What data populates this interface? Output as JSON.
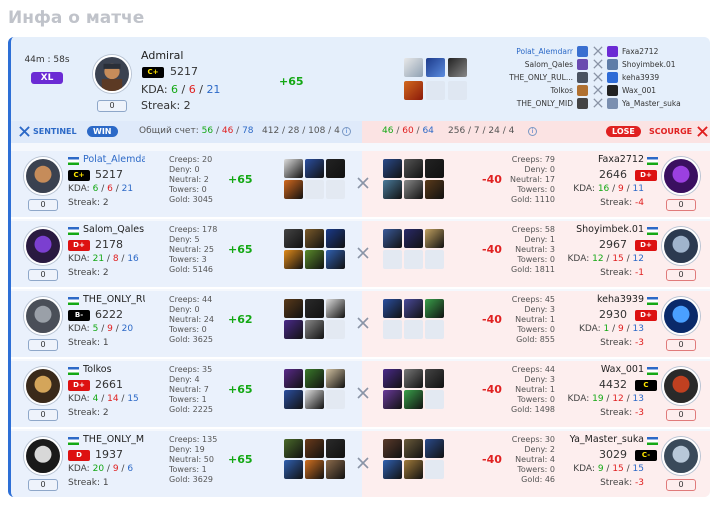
{
  "page": {
    "title": "Инфа о матче"
  },
  "header": {
    "duration": "44m : 58s",
    "mode": "XL",
    "player": {
      "name": "Admiral",
      "rank": "C+",
      "rating": "5217",
      "kda_label": "KDA:",
      "kills": "6",
      "deaths": "6",
      "assists": "21",
      "streak_label": "Streak:",
      "streak": "2",
      "pill": "0",
      "diff": "+65"
    },
    "matchups": [
      {
        "left": "Polat_Alemdarr",
        "right": "Faxa2712"
      },
      {
        "left": "Salom_Qales",
        "right": "Shoyimbek.01"
      },
      {
        "left": "THE_ONLY_RUL...",
        "right": "keha3939"
      },
      {
        "left": "Tolkos",
        "right": "Wax_001"
      },
      {
        "left": "THE_ONLY_MID",
        "right": "Ya_Master_suka"
      }
    ]
  },
  "scorebar": {
    "sentinel": "SENTINEL",
    "win": "WIN",
    "total_label": "Общий счет:",
    "score_k": "56",
    "score_d": "46",
    "score_a": "78",
    "totals": "412 / 28 / 108 / 4",
    "right_k": "46",
    "right_d": "60",
    "right_a": "64",
    "right_totals": "256 / 7 / 24 / 4",
    "lose": "LOSE",
    "scourge": "SCOURGE"
  },
  "colors": {
    "accent": "#2d6fd6",
    "win": "#2c69c7",
    "lose": "#e02020",
    "rank_c": "#ffe600"
  },
  "rows": [
    {
      "left": {
        "name": "Polat_Alemdarr",
        "rank": "C+",
        "rank_class": "c",
        "rating": "5217",
        "kills": "6",
        "deaths": "6",
        "assists": "21",
        "streak": "2",
        "pill": "0",
        "creeps": "20",
        "deny": "0",
        "neutral": "2",
        "towers": "0",
        "gold": "3045",
        "diff": "+65"
      },
      "right": {
        "name": "Faxa2712",
        "rank": "D+",
        "rank_class": "d",
        "rating": "2646",
        "kills": "16",
        "deaths": "9",
        "assists": "11",
        "streak": "-4",
        "pill": "0",
        "creeps": "79",
        "deny": "0",
        "neutral": "17",
        "towers": "0",
        "gold": "1110",
        "diff": "-40"
      }
    },
    {
      "left": {
        "name": "Salom_Qales",
        "rank": "D+",
        "rank_class": "d",
        "rating": "2178",
        "kills": "21",
        "deaths": "8",
        "assists": "16",
        "streak": "2",
        "pill": "0",
        "creeps": "178",
        "deny": "5",
        "neutral": "25",
        "towers": "3",
        "gold": "5146",
        "diff": "+65"
      },
      "right": {
        "name": "Shoyimbek.01",
        "rank": "D+",
        "rank_class": "d",
        "rating": "2967",
        "kills": "12",
        "deaths": "15",
        "assists": "12",
        "streak": "-1",
        "pill": "0",
        "creeps": "58",
        "deny": "1",
        "neutral": "3",
        "towers": "0",
        "gold": "1811",
        "diff": "-40"
      }
    },
    {
      "left": {
        "name": "THE_ONLY_RULER",
        "rank": "B-",
        "rank_class": "b",
        "rating": "6222",
        "kills": "5",
        "deaths": "9",
        "assists": "20",
        "streak": "1",
        "pill": "0",
        "creeps": "44",
        "deny": "0",
        "neutral": "24",
        "towers": "0",
        "gold": "3625",
        "diff": "+62"
      },
      "right": {
        "name": "keha3939",
        "rank": "D+",
        "rank_class": "d",
        "rating": "2930",
        "kills": "1",
        "deaths": "9",
        "assists": "13",
        "streak": "-3",
        "pill": "0",
        "creeps": "45",
        "deny": "3",
        "neutral": "1",
        "towers": "0",
        "gold": "855",
        "diff": "-40"
      }
    },
    {
      "left": {
        "name": "Tolkos",
        "rank": "D+",
        "rank_class": "d",
        "rating": "2661",
        "kills": "4",
        "deaths": "14",
        "assists": "15",
        "streak": "2",
        "pill": "0",
        "creeps": "35",
        "deny": "4",
        "neutral": "7",
        "towers": "1",
        "gold": "2225",
        "diff": "+65"
      },
      "right": {
        "name": "Wax_001",
        "rank": "C",
        "rank_class": "c",
        "rating": "4432",
        "kills": "19",
        "deaths": "12",
        "assists": "13",
        "streak": "-3",
        "pill": "0",
        "creeps": "44",
        "deny": "3",
        "neutral": "1",
        "towers": "0",
        "gold": "1498",
        "diff": "-40"
      }
    },
    {
      "left": {
        "name": "THE_ONLY_MID",
        "rank": "D",
        "rank_class": "d",
        "rating": "1937",
        "kills": "20",
        "deaths": "9",
        "assists": "6",
        "streak": "1",
        "pill": "0",
        "creeps": "135",
        "deny": "19",
        "neutral": "50",
        "towers": "1",
        "gold": "3629",
        "diff": "+65"
      },
      "right": {
        "name": "Ya_Master_suka",
        "rank": "C-",
        "rank_class": "c",
        "rating": "3029",
        "kills": "9",
        "deaths": "15",
        "assists": "15",
        "streak": "-3",
        "pill": "0",
        "creeps": "30",
        "deny": "2",
        "neutral": "4",
        "towers": "0",
        "gold": "46",
        "diff": "-40"
      }
    }
  ],
  "labels": {
    "creeps": "Creeps:",
    "deny": "Deny:",
    "neutral": "Neutral:",
    "towers": "Towers:",
    "gold": "Gold:",
    "kda": "KDA:",
    "streak": "Streak:"
  }
}
